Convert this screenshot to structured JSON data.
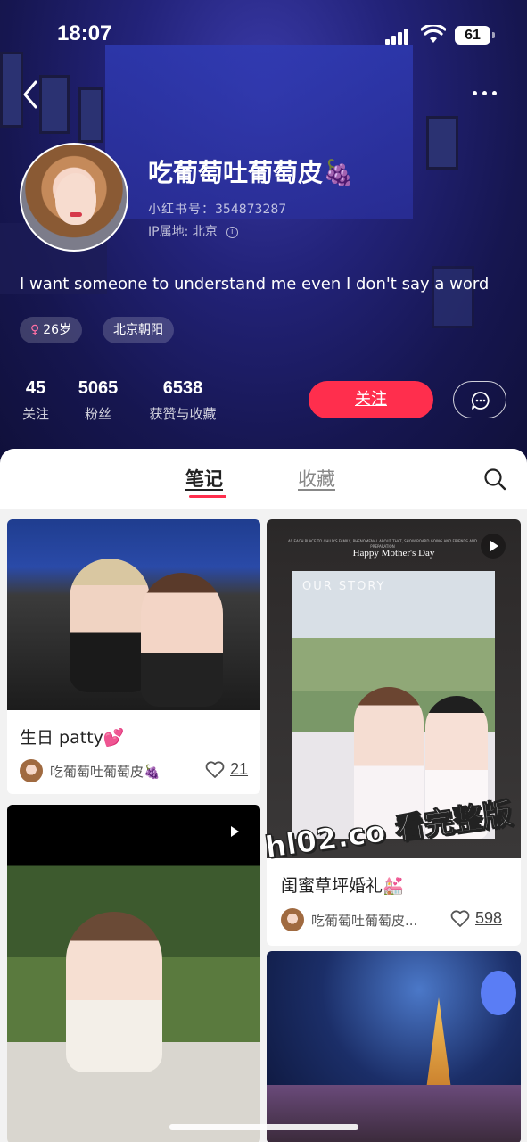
{
  "status_bar": {
    "time": "18:07",
    "battery": "61"
  },
  "profile": {
    "nickname": "吃葡萄吐葡萄皮🍇",
    "red_id_label": "小红书号：",
    "red_id": "354873287",
    "ip_label": "IP属地: ",
    "ip_location": "北京",
    "bio": "I want someone to understand me even I don't say a word",
    "gender_symbol": "♀",
    "age": "26岁",
    "location_tag": "北京朝阳",
    "stats": [
      {
        "value": "45",
        "label": "关注"
      },
      {
        "value": "5065",
        "label": "粉丝"
      },
      {
        "value": "6538",
        "label": "获赞与收藏"
      }
    ],
    "follow_label": "关注"
  },
  "tabs": [
    {
      "label": "笔记",
      "active": true
    },
    {
      "label": "收藏",
      "active": false
    }
  ],
  "notes": [
    {
      "title": "生日 patty💕",
      "author": "吃葡萄吐葡萄皮🍇",
      "likes": "21",
      "video": false
    },
    {
      "title": "闺蜜草坪婚礼💒",
      "author": "吃葡萄吐葡萄皮...",
      "likes": "598",
      "video": true,
      "cover_text": {
        "heading": "Happy Mother's Day",
        "overlay": "OUR STORY",
        "fine_print": "AS EACH PLACE TO CHILD'S FAMILY, PHENOMENAL ABOUT THAT, SHOW BOARD GOING AND FRIENDS AND PREPARATION"
      }
    },
    {
      "video": true
    },
    {
      "video": false
    }
  ],
  "watermark": "hl02.co 看完整版",
  "colors": {
    "accent": "#ff2e4d",
    "header_bg": "#1d1d6a"
  }
}
